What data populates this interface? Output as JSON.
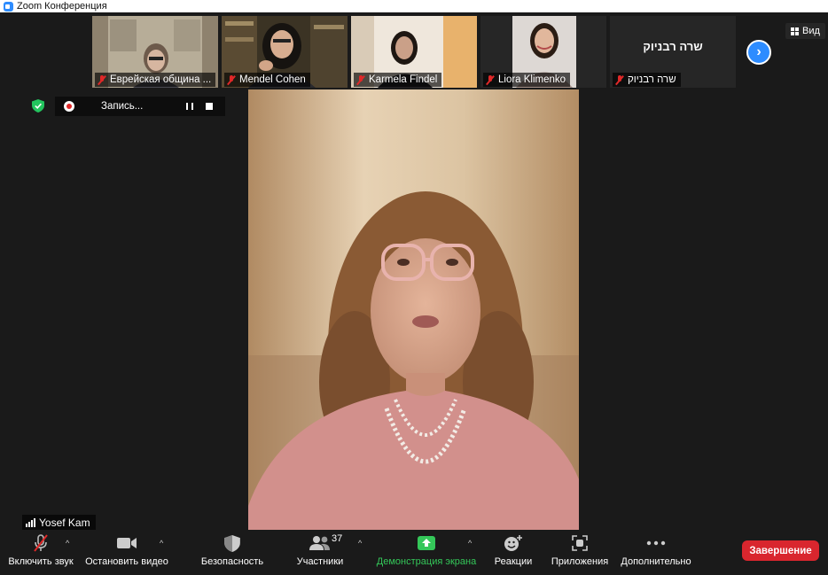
{
  "window": {
    "title": "Zoom Конференция"
  },
  "participants_strip": [
    {
      "name": "Еврейская община ...",
      "muted": true
    },
    {
      "name": "Mendel Cohen",
      "muted": true
    },
    {
      "name": "Karmela Findel",
      "muted": true
    },
    {
      "name": "Liora Klimenko",
      "muted": true
    },
    {
      "name": "שרה רבניוק",
      "muted": true,
      "video_off": true
    }
  ],
  "view_button": {
    "label": "Вид"
  },
  "recording": {
    "label": "Запись..."
  },
  "active_speaker": {
    "name": "Yosef Kam"
  },
  "toolbar": {
    "unmute": "Включить звук",
    "stop_video": "Остановить видео",
    "security": "Безопасность",
    "participants": "Участники",
    "participants_count": "37",
    "share_screen": "Демонстрация экрана",
    "reactions": "Реакции",
    "apps": "Приложения",
    "more": "Дополнительно",
    "end": "Завершение"
  },
  "colors": {
    "accent": "#2d8cff",
    "end_button": "#d9262e",
    "share_green": "#34c759",
    "muted_red": "#e02828",
    "secure_green": "#23c45e"
  }
}
